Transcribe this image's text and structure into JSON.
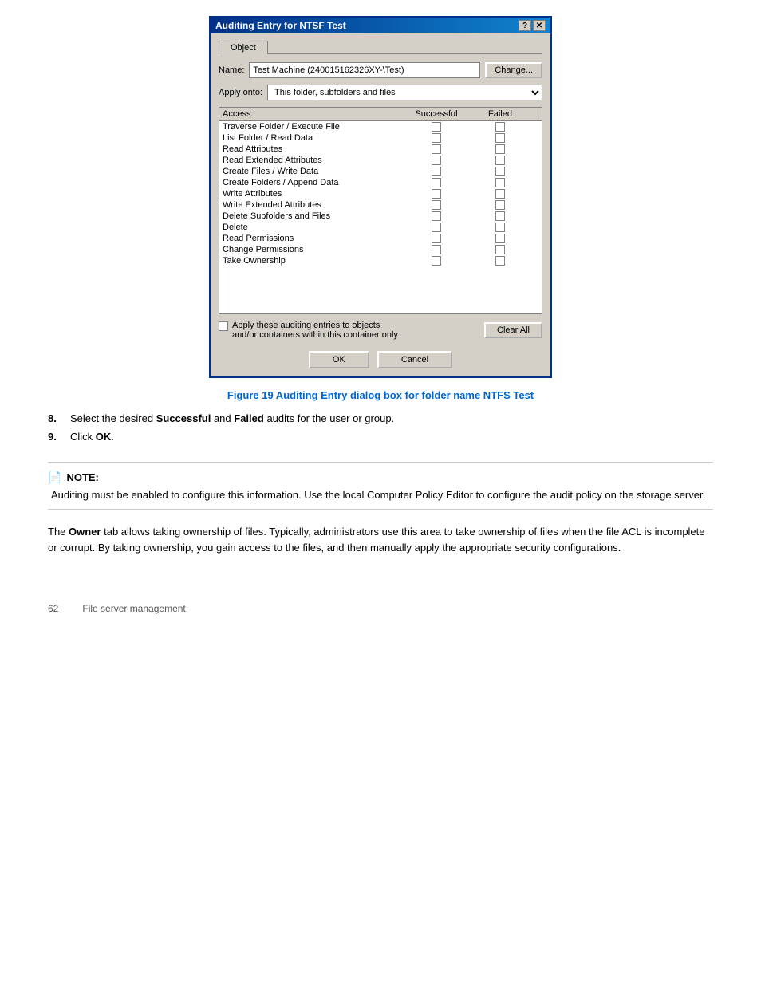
{
  "dialog": {
    "title": "Auditing Entry for NTSF Test",
    "tab_label": "Object",
    "name_label": "Name:",
    "name_value": "Test Machine (240015162326XY-\\Test)",
    "change_button": "Change...",
    "apply_onto_label": "Apply onto:",
    "apply_onto_value": "This folder, subfolders and files",
    "access_label": "Access:",
    "col_successful": "Successful",
    "col_failed": "Failed",
    "access_rows": [
      "Traverse Folder / Execute File",
      "List Folder / Read Data",
      "Read Attributes",
      "Read Extended Attributes",
      "Create Files / Write Data",
      "Create Folders / Append Data",
      "Write Attributes",
      "Write Extended Attributes",
      "Delete Subfolders and Files",
      "Delete",
      "Read Permissions",
      "Change Permissions",
      "Take Ownership"
    ],
    "apply_text_line1": "Apply these auditing entries to objects",
    "apply_text_line2": "and/or containers within this container only",
    "clear_all_button": "Clear All",
    "ok_button": "OK",
    "cancel_button": "Cancel"
  },
  "figure_caption": "Figure 19 Auditing Entry dialog box for folder name NTFS Test",
  "steps": [
    {
      "number": "8.",
      "text_before": "Select the desired ",
      "bold1": "Successful",
      "text_mid": " and ",
      "bold2": "Failed",
      "text_after": " audits for the user or group."
    },
    {
      "number": "9.",
      "text_before": "Click ",
      "bold1": "OK",
      "text_after": "."
    }
  ],
  "note": {
    "label": "NOTE:",
    "text": "Auditing must be enabled to configure this information. Use the local Computer Policy Editor to configure the audit policy on the storage server."
  },
  "owner_paragraph": {
    "text_before": "The ",
    "bold": "Owner",
    "text_after": " tab allows taking ownership of files. Typically, administrators use this area to take ownership of files when the file ACL is incomplete or corrupt. By taking ownership, you gain access to the files, and then manually apply the appropriate security configurations."
  },
  "page_footer": {
    "page_number": "62",
    "label": "File server management"
  }
}
